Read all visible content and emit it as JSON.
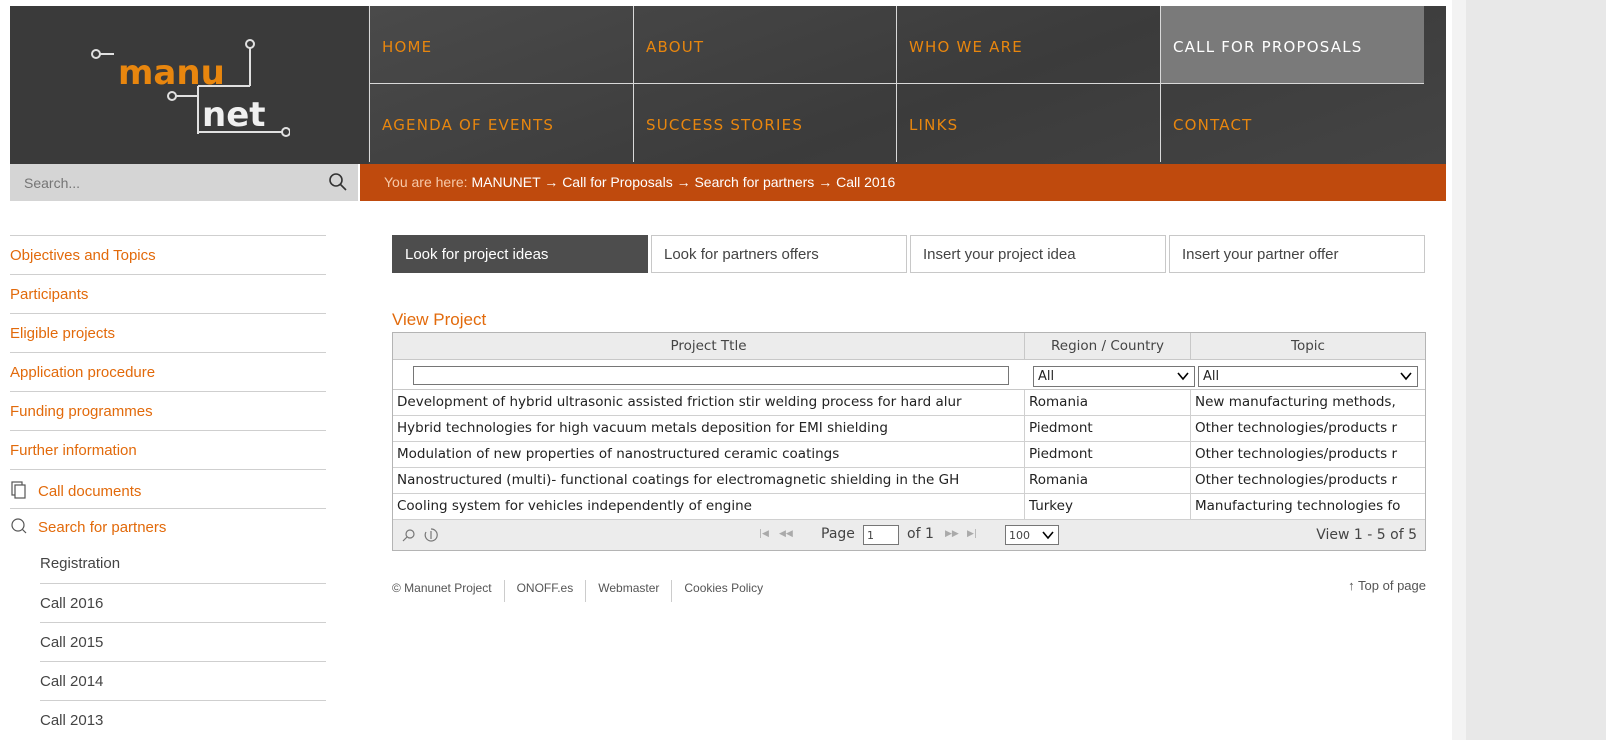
{
  "nav": {
    "row1": [
      "HOME",
      "ABOUT",
      "WHO WE ARE",
      "CALL FOR PROPOSALS"
    ],
    "row2": [
      "AGENDA OF EVENTS",
      "SUCCESS STORIES",
      "LINKS",
      "CONTACT"
    ],
    "active": "CALL FOR PROPOSALS"
  },
  "search": {
    "placeholder": "Search..."
  },
  "breadcrumb": {
    "prefix": "You are here:",
    "path": "MANUNET → Call for Proposals → Search for partners → Call 2016"
  },
  "sidebar": {
    "links": [
      "Objectives and Topics",
      "Participants",
      "Eligible projects",
      "Application procedure",
      "Funding programmes",
      "Further information"
    ],
    "call_documents": "Call documents",
    "search_partners": "Search for partners",
    "sub_items": [
      "Registration",
      "Call 2016",
      "Call 2015",
      "Call 2014",
      "Call 2013"
    ]
  },
  "tabs": [
    "Look for project ideas",
    "Look for partners offers",
    "Insert your project idea",
    "Insert your partner offer"
  ],
  "view_title": "View Project",
  "grid": {
    "columns": [
      "Project Ttle",
      "Region / Country",
      "Topic"
    ],
    "filter_region": "All",
    "filter_topic": "All",
    "rows": [
      {
        "title": "Development of hybrid ultrasonic assisted friction stir welding process for hard alur",
        "region": "Romania",
        "topic": "New manufacturing methods,"
      },
      {
        "title": "Hybrid technologies for high vacuum metals deposition for EMI shielding",
        "region": "Piedmont",
        "topic": "Other technologies/products r"
      },
      {
        "title": "Modulation of new properties of nanostructured ceramic coatings",
        "region": "Piedmont",
        "topic": "Other technologies/products r"
      },
      {
        "title": "Nanostructured (multi)- functional coatings for electromagnetic shielding in the GH",
        "region": "Romania",
        "topic": "Other technologies/products r"
      },
      {
        "title": "Cooling system for vehicles independently of engine",
        "region": "Turkey",
        "topic": "Manufacturing technologies fo"
      }
    ],
    "pager": {
      "page_label": "Page",
      "page_value": "1",
      "of_label": "of 1",
      "page_size": "100",
      "view_text": "View 1 - 5 of 5"
    }
  },
  "footer": {
    "items": [
      "© Manunet Project",
      "ONOFF.es",
      "Webmaster",
      "Cookies Policy"
    ],
    "top_link": "↑ Top of page"
  },
  "colors": {
    "accent_orange": "#e26a0b",
    "breadcrumb_bar": "#bf4a0d",
    "header_dark": "#3f3f3f"
  }
}
